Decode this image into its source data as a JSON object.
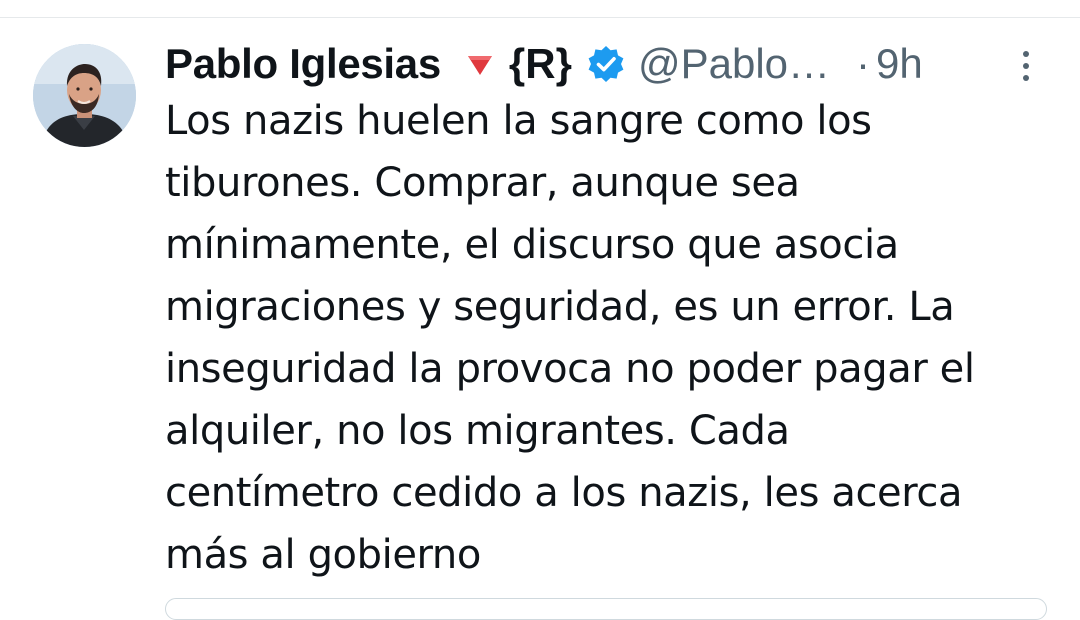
{
  "tweet": {
    "author": {
      "display_name": "Pablo Iglesias",
      "flag_icon": "red-triangle-icon",
      "affiliation": "{R}",
      "verified_icon": "verified-badge-icon",
      "handle": "@Pablo…"
    },
    "separator": "·",
    "time": "9h",
    "more_icon": "more-vertical-icon",
    "text": "Los nazis huelen la sangre como los\ntiburones. Comprar, aunque sea\nmínimamente, el discurso que asocia\nmigraciones y seguridad, es un error. La\ninseguridad la provoca no poder pagar el\nalquiler, no los migrantes. Cada\ncentímetro cedido a los nazis, les acerca\nmás al gobierno"
  },
  "colors": {
    "text": "#0f1419",
    "secondary": "#536471",
    "verified": "#1d9bf0",
    "flag": "#e0393e"
  }
}
